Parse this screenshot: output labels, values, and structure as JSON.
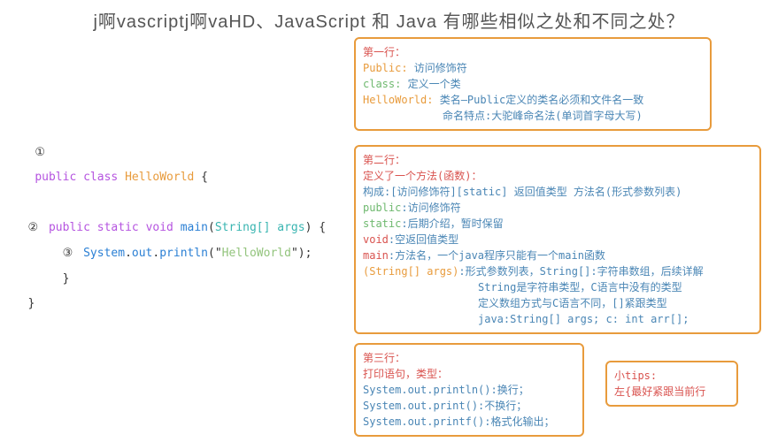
{
  "title": "j啊vascriptj啊vaHD、JavaScript 和 Java 有哪些相似之处和不同之处？",
  "code": {
    "num1": "①",
    "num2": "②",
    "num3": "③",
    "l1_a": "public",
    "l1_b": "class",
    "l1_c": "HelloWorld",
    "l1_d": " {",
    "l2_a": "public",
    "l2_b": "static",
    "l2_c": "void",
    "l2_d": "main",
    "l2_e": "(",
    "l2_f": "String[] args",
    "l2_g": ") {",
    "l3_a": "System",
    "l3_b": ".",
    "l3_c": "out",
    "l3_d": ".",
    "l3_e": "println",
    "l3_f": "(\"",
    "l3_g": "HelloWorld",
    "l3_h": "\");",
    "l4": "}",
    "l5": "}"
  },
  "box1": {
    "h": "第一行：",
    "a1": "Public:",
    "a2": " 访问修饰符",
    "b1": "class:",
    "b2": " 定义一个类",
    "c1": "HelloWorld:",
    "c2": " 类名—Public定义的类名必须和文件名一致",
    "c3": "命名特点:大驼峰命名法(单词首字母大写)"
  },
  "box2": {
    "h": "第二行：",
    "sub": "定义了一个方法(函数)：",
    "a": "构成:[访问修饰符][static] 返回值类型 方法名(形式参数列表)",
    "b1": "public",
    "b2": ":访问修饰符",
    "c1": "static",
    "c2": ":后期介绍，暂时保留",
    "d1": "void",
    "d2": ":空返回值类型",
    "e1": "main",
    "e2": ":方法名，一个java程序只能有一个main函数",
    "f1": "(String[] args)",
    "f2": ":形式参数列表，String[]:字符串数组，后续详解",
    "f3": "String是字符串类型，C语言中没有的类型",
    "f4": "定义数组方式与C语言不同，[]紧跟类型",
    "f5": "java:String[] args; c: int arr[];"
  },
  "box3": {
    "h": "第三行：",
    "s": "打印语句，类型：",
    "a1": "System.out.println()",
    "a2": ":换行；",
    "b1": "System.out.print()",
    "b2": ":不换行；",
    "c1": "System.out.printf()",
    "c2": ":格式化输出；"
  },
  "tips": {
    "h": "小tips:",
    "t": "左{最好紧跟当前行"
  }
}
